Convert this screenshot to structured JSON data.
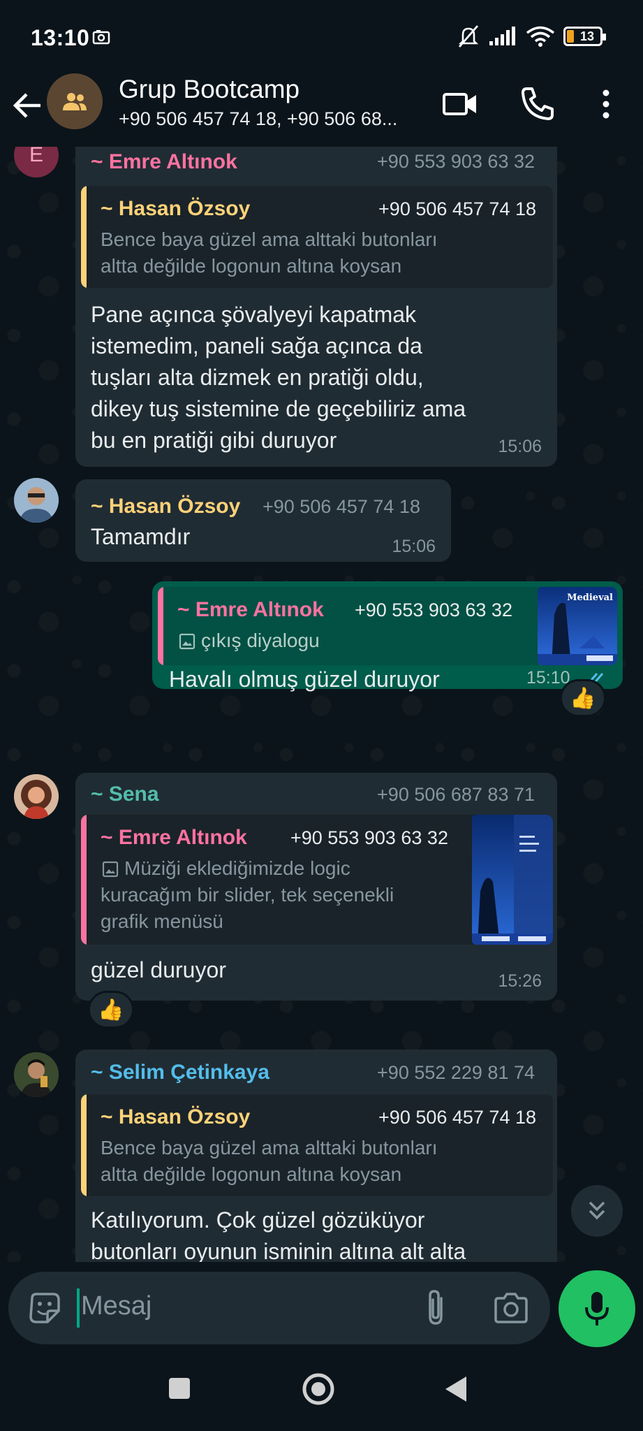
{
  "status_bar": {
    "time": "13:10",
    "battery": "13"
  },
  "header": {
    "title": "Grup Bootcamp",
    "subtitle": "+90 506 457 74 18, +90 506 68..."
  },
  "messages": [
    {
      "sender": "~ Emre Altınok",
      "sender_initial": "E",
      "phone": "+90 553 903 63 32",
      "quote_sender": "~ Hasan Özsoy",
      "quote_phone": "+90 506 457 74 18",
      "quote_text_1": "Bence baya güzel ama alttaki butonları",
      "quote_text_2": "altta değilde logonun altına koysan",
      "text_1": "Pane açınca şövalyeyi kapatmak",
      "text_2": "istemedim, paneli sağa açınca da",
      "text_3": "tuşları alta dizmek en pratiği oldu,",
      "text_4": "dikey tuş sistemine de geçebiliriz ama",
      "text_5": "bu en pratiği gibi duruyor",
      "time": "15:06"
    },
    {
      "sender": "~ Hasan Özsoy",
      "phone": "+90 506 457 74 18",
      "text": "Tamamdır",
      "time": "15:06"
    },
    {
      "quote_sender": "~ Emre Altınok",
      "quote_phone": "+90 553 903 63 32",
      "quote_text": "çıkış diyalogu",
      "thumb_title": "Medieval",
      "text": "Havalı olmuş güzel duruyor",
      "time": "15:10",
      "reaction": "👍"
    },
    {
      "sender": "~ Sena",
      "phone": "+90 506 687 83 71",
      "quote_sender": "~ Emre Altınok",
      "quote_phone": "+90 553 903 63 32",
      "quote_text_1": "Müziği eklediğimizde logic",
      "quote_text_2": "kuracağım bir slider, tek seçenekli",
      "quote_text_3": "grafik menüsü",
      "text": "güzel duruyor",
      "time": "15:26",
      "reaction": "👍"
    },
    {
      "sender": "~ Selim Çetinkaya",
      "phone": "+90 552 229 81 74",
      "quote_sender": "~ Hasan Özsoy",
      "quote_phone": "+90 506 457 74 18",
      "quote_text_1": "Bence baya güzel ama alttaki butonları",
      "quote_text_2": "altta değilde logonun altına koysan",
      "text_1": "Katılıyorum. Çok güzel gözüküyor",
      "text_2": "butonları oyunun isminin altına alt alta"
    }
  ],
  "input": {
    "placeholder": "Mesaj"
  },
  "colors": {
    "background": "#0b141a",
    "bubble_in": "#202c33",
    "bubble_out": "#005c4b",
    "accent_green": "#21c063",
    "name_emre": "#ff72a1",
    "name_hasan": "#ffd279",
    "name_sena": "#53bdac",
    "name_selim": "#53bdeb"
  }
}
